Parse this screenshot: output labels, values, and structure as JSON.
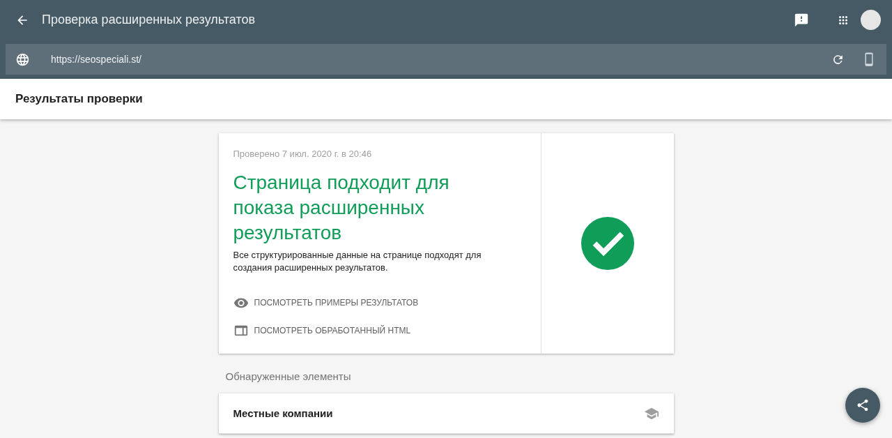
{
  "app_bar": {
    "title": "Проверка расширенных результатов"
  },
  "url_bar": {
    "value": "https://seospeciali.st/"
  },
  "header": {
    "title": "Результаты проверки"
  },
  "result": {
    "checked_at": "Проверено 7 июл. 2020 г. в 20:46",
    "heading": "Страница подходит для показа расширенных результатов",
    "description": "Все структурированные данные на странице подходят для создания расширенных результатов.",
    "valid": true,
    "links": [
      {
        "kind": "examples",
        "label": "ПОСМОТРЕТЬ ПРИМЕРЫ РЕЗУЛЬТАТОВ"
      },
      {
        "kind": "html",
        "label": "ПОСМОТРЕТЬ ОБРАБОТАННЫЙ HTML"
      }
    ]
  },
  "detected": {
    "title": "Обнаруженные элементы",
    "items": [
      {
        "label": "Местные компании"
      }
    ]
  }
}
